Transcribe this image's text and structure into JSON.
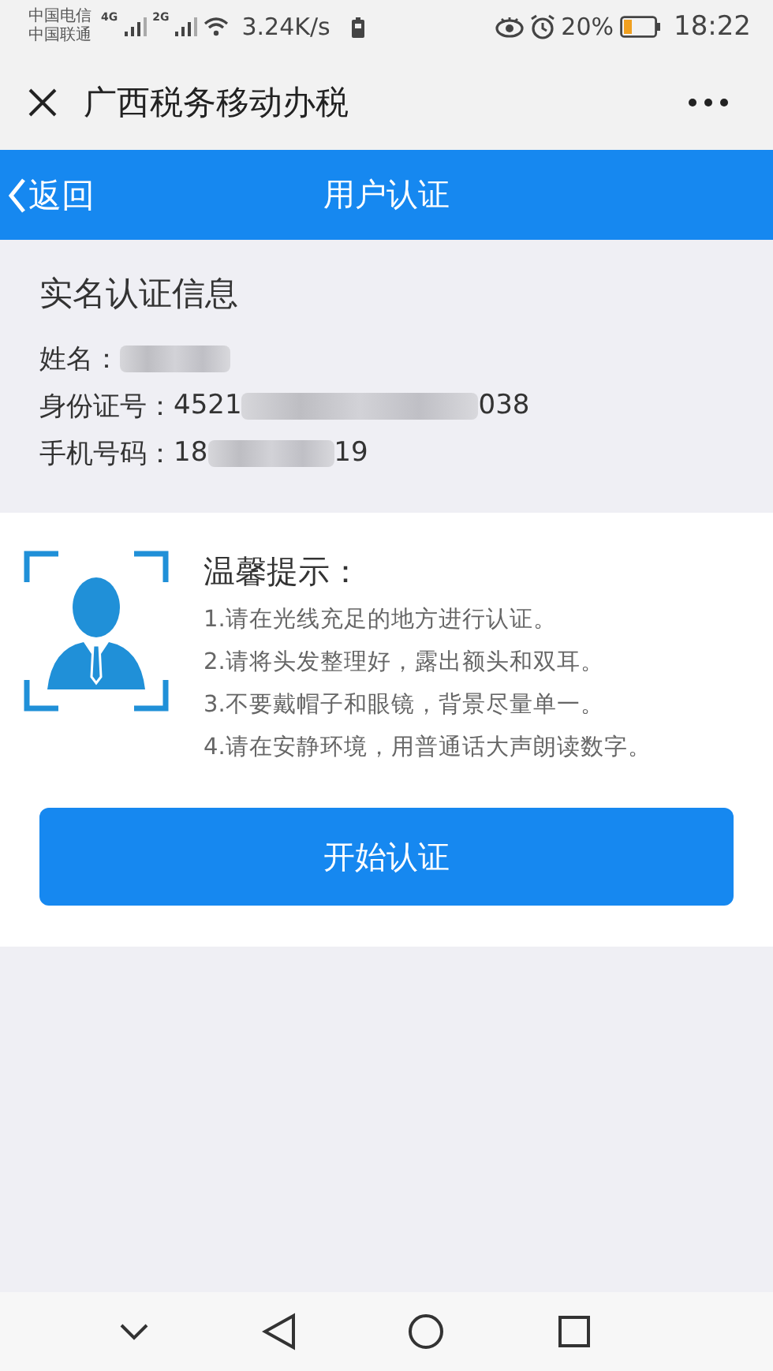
{
  "status_bar": {
    "carriers": [
      "中国电信",
      "中国联通"
    ],
    "networks": [
      "4G",
      "2G"
    ],
    "speed": "3.24K/s",
    "battery_text": "20%",
    "time": "18:22"
  },
  "title_bar": {
    "title": "广西税务移动办税"
  },
  "header": {
    "back": "返回",
    "title": "用户认证"
  },
  "info": {
    "heading": "实名认证信息",
    "fields": [
      {
        "label": "姓名：",
        "masked": true
      },
      {
        "label": "身份证号：",
        "value_start": "4521",
        "value_end": "038",
        "masked": true
      },
      {
        "label": "手机号码：",
        "value_start": "18",
        "value_end": "19",
        "masked": true
      }
    ]
  },
  "tips": {
    "title": "温馨提示：",
    "items": [
      "1.请在光线充足的地方进行认证。",
      "2.请将头发整理好，露出额头和双耳。",
      "3.不要戴帽子和眼镜，背景尽量单一。",
      "4.请在安静环境，用普通话大声朗读数字。"
    ]
  },
  "button": "开始认证"
}
